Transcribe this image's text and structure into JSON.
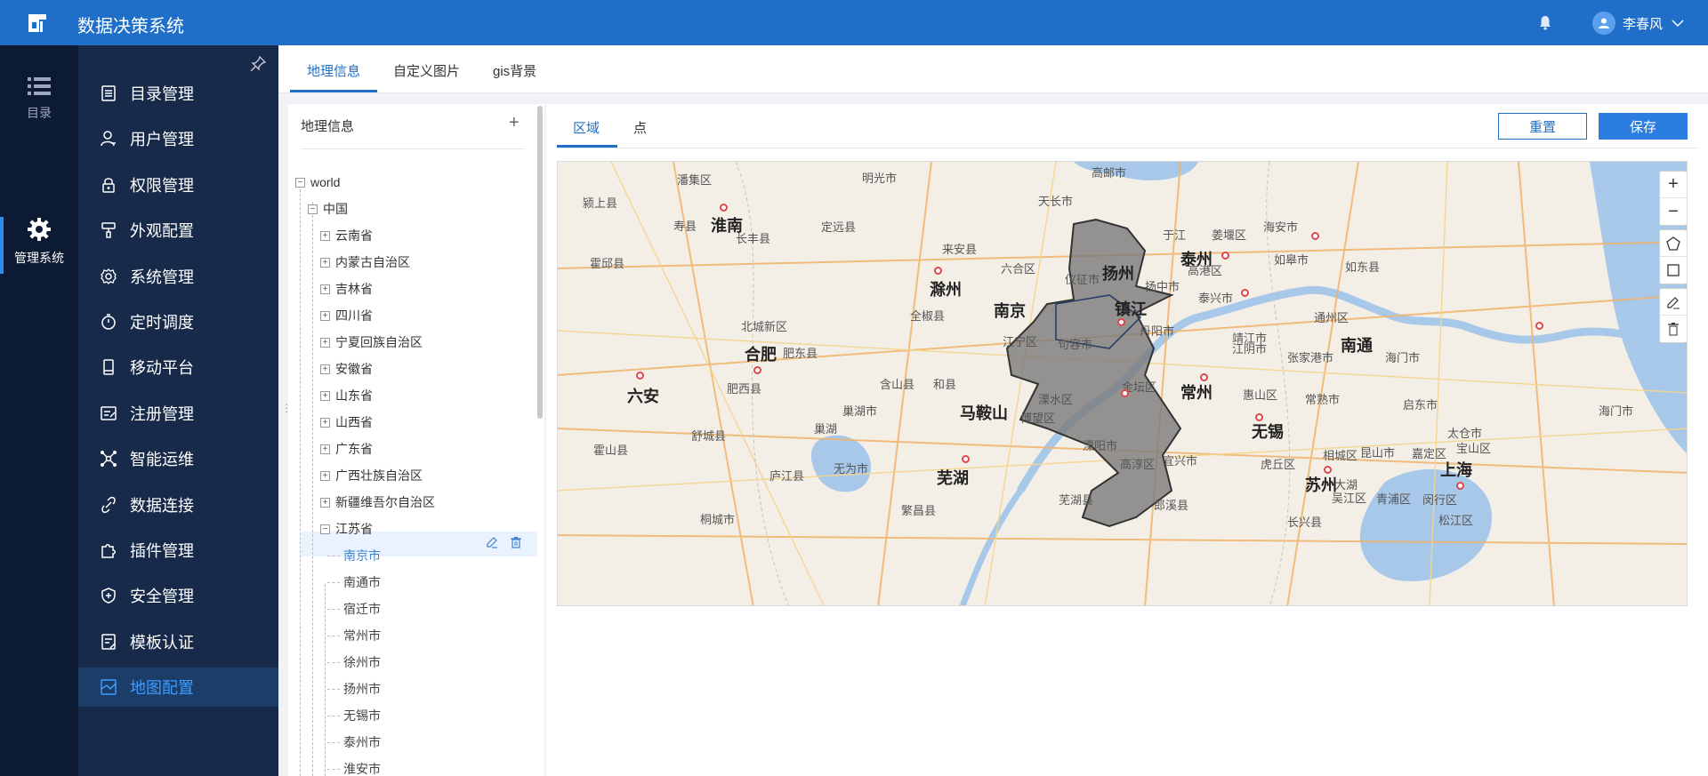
{
  "header": {
    "title": "数据决策系统",
    "user_name": "李春风"
  },
  "rail": [
    {
      "label": "目录"
    },
    {
      "label": "管理系统"
    }
  ],
  "menu": [
    {
      "label": "目录管理",
      "icon": "catalog-icon"
    },
    {
      "label": "用户管理",
      "icon": "user-manage-icon"
    },
    {
      "label": "权限管理",
      "icon": "lock-icon"
    },
    {
      "label": "外观配置",
      "icon": "brush-icon"
    },
    {
      "label": "系统管理",
      "icon": "gear-icon"
    },
    {
      "label": "定时调度",
      "icon": "stopwatch-icon"
    },
    {
      "label": "移动平台",
      "icon": "mobile-icon"
    },
    {
      "label": "注册管理",
      "icon": "register-icon"
    },
    {
      "label": "智能运维",
      "icon": "network-icon"
    },
    {
      "label": "数据连接",
      "icon": "link-icon"
    },
    {
      "label": "插件管理",
      "icon": "puzzle-icon"
    },
    {
      "label": "安全管理",
      "icon": "shield-icon"
    },
    {
      "label": "模板认证",
      "icon": "template-icon"
    },
    {
      "label": "地图配置",
      "icon": "map-icon",
      "active": true
    }
  ],
  "tabs": [
    {
      "label": "地理信息",
      "active": true
    },
    {
      "label": "自定义图片"
    },
    {
      "label": "gis背景"
    }
  ],
  "geo_panel": {
    "title": "地理信息",
    "add_symbol": "+",
    "tree": [
      {
        "label": "world",
        "level": 0,
        "toggle": "−"
      },
      {
        "label": "中国",
        "level": 1,
        "toggle": "−"
      },
      {
        "label": "云南省",
        "level": 2,
        "toggle": "+"
      },
      {
        "label": "内蒙古自治区",
        "level": 2,
        "toggle": "+"
      },
      {
        "label": "吉林省",
        "level": 2,
        "toggle": "+"
      },
      {
        "label": "四川省",
        "level": 2,
        "toggle": "+"
      },
      {
        "label": "宁夏回族自治区",
        "level": 2,
        "toggle": "+"
      },
      {
        "label": "安徽省",
        "level": 2,
        "toggle": "+"
      },
      {
        "label": "山东省",
        "level": 2,
        "toggle": "+"
      },
      {
        "label": "山西省",
        "level": 2,
        "toggle": "+"
      },
      {
        "label": "广东省",
        "level": 2,
        "toggle": "+"
      },
      {
        "label": "广西壮族自治区",
        "level": 2,
        "toggle": "+"
      },
      {
        "label": "新疆维吾尔自治区",
        "level": 2,
        "toggle": "+"
      },
      {
        "label": "江苏省",
        "level": 2,
        "toggle": "−"
      },
      {
        "label": "南京市",
        "level": 3,
        "selected": true
      },
      {
        "label": "南通市",
        "level": 3
      },
      {
        "label": "宿迁市",
        "level": 3
      },
      {
        "label": "常州市",
        "level": 3
      },
      {
        "label": "徐州市",
        "level": 3
      },
      {
        "label": "扬州市",
        "level": 3
      },
      {
        "label": "无锡市",
        "level": 3
      },
      {
        "label": "泰州市",
        "level": 3
      },
      {
        "label": "淮安市",
        "level": 3
      }
    ]
  },
  "editor": {
    "sub_tabs": [
      {
        "label": "区域",
        "active": true
      },
      {
        "label": "点"
      }
    ],
    "reset_label": "重置",
    "save_label": "保存"
  },
  "map": {
    "controls": {
      "zoom_in": "+",
      "zoom_out": "−"
    },
    "highlight_color": "#7a7a7a",
    "labels": [
      {
        "text": "潘集区"
      },
      {
        "text": "明光市"
      },
      {
        "text": "高邮市"
      },
      {
        "text": "天长市"
      },
      {
        "text": "颍上县"
      },
      {
        "text": "寿县"
      },
      {
        "text": "淮南",
        "big": true
      },
      {
        "text": "长丰县"
      },
      {
        "text": "定远县"
      },
      {
        "text": "来安县"
      },
      {
        "text": "滁州",
        "big": true
      },
      {
        "text": "六合区"
      },
      {
        "text": "仪征市"
      },
      {
        "text": "扬州",
        "big": true
      },
      {
        "text": "泰州",
        "big": true
      },
      {
        "text": "姜堰区"
      },
      {
        "text": "海安市"
      },
      {
        "text": "霍邱县"
      },
      {
        "text": "于江"
      },
      {
        "text": "高港区"
      },
      {
        "text": "扬中市"
      },
      {
        "text": "泰兴市"
      },
      {
        "text": "如皋市"
      },
      {
        "text": "如东县"
      },
      {
        "text": "北城新区"
      },
      {
        "text": "全椒县"
      },
      {
        "text": "南京",
        "big": true
      },
      {
        "text": "镇江",
        "big": true
      },
      {
        "text": "丹阳市"
      },
      {
        "text": "靖江市"
      },
      {
        "text": "江阴市"
      },
      {
        "text": "通州区"
      },
      {
        "text": "南通",
        "big": true
      },
      {
        "text": "合肥",
        "big": true
      },
      {
        "text": "肥东县"
      },
      {
        "text": "江宁区"
      },
      {
        "text": "句容市"
      },
      {
        "text": "张家港市"
      },
      {
        "text": "海门市"
      },
      {
        "text": "六安",
        "big": true
      },
      {
        "text": "肥西县"
      },
      {
        "text": "含山县"
      },
      {
        "text": "和县"
      },
      {
        "text": "金坛区"
      },
      {
        "text": "常州",
        "big": true
      },
      {
        "text": "惠山区"
      },
      {
        "text": "常熟市"
      },
      {
        "text": "启东市"
      },
      {
        "text": "巢湖"
      },
      {
        "text": "巢湖市"
      },
      {
        "text": "马鞍山",
        "big": true
      },
      {
        "text": "博望区"
      },
      {
        "text": "溧水区"
      },
      {
        "text": "无锡",
        "big": true
      },
      {
        "text": "太仓市"
      },
      {
        "text": "宝山区"
      },
      {
        "text": "舒城县"
      },
      {
        "text": "溧阳市"
      },
      {
        "text": "宜兴市"
      },
      {
        "text": "大湖"
      },
      {
        "text": "相城区"
      },
      {
        "text": "昆山市"
      },
      {
        "text": "嘉定区"
      },
      {
        "text": "霍山县"
      },
      {
        "text": "庐江县"
      },
      {
        "text": "无为市"
      },
      {
        "text": "芜湖",
        "big": true
      },
      {
        "text": "高淳区"
      },
      {
        "text": "虎丘区"
      },
      {
        "text": "苏州",
        "big": true
      },
      {
        "text": "上海",
        "big": true
      },
      {
        "text": "吴江区"
      },
      {
        "text": "青浦区"
      },
      {
        "text": "闵行区"
      },
      {
        "text": "桐城市"
      },
      {
        "text": "繁昌县"
      },
      {
        "text": "芜湖县"
      },
      {
        "text": "郎溪县"
      },
      {
        "text": "长兴县"
      },
      {
        "text": "松江区"
      },
      {
        "text": "海门市"
      }
    ]
  }
}
